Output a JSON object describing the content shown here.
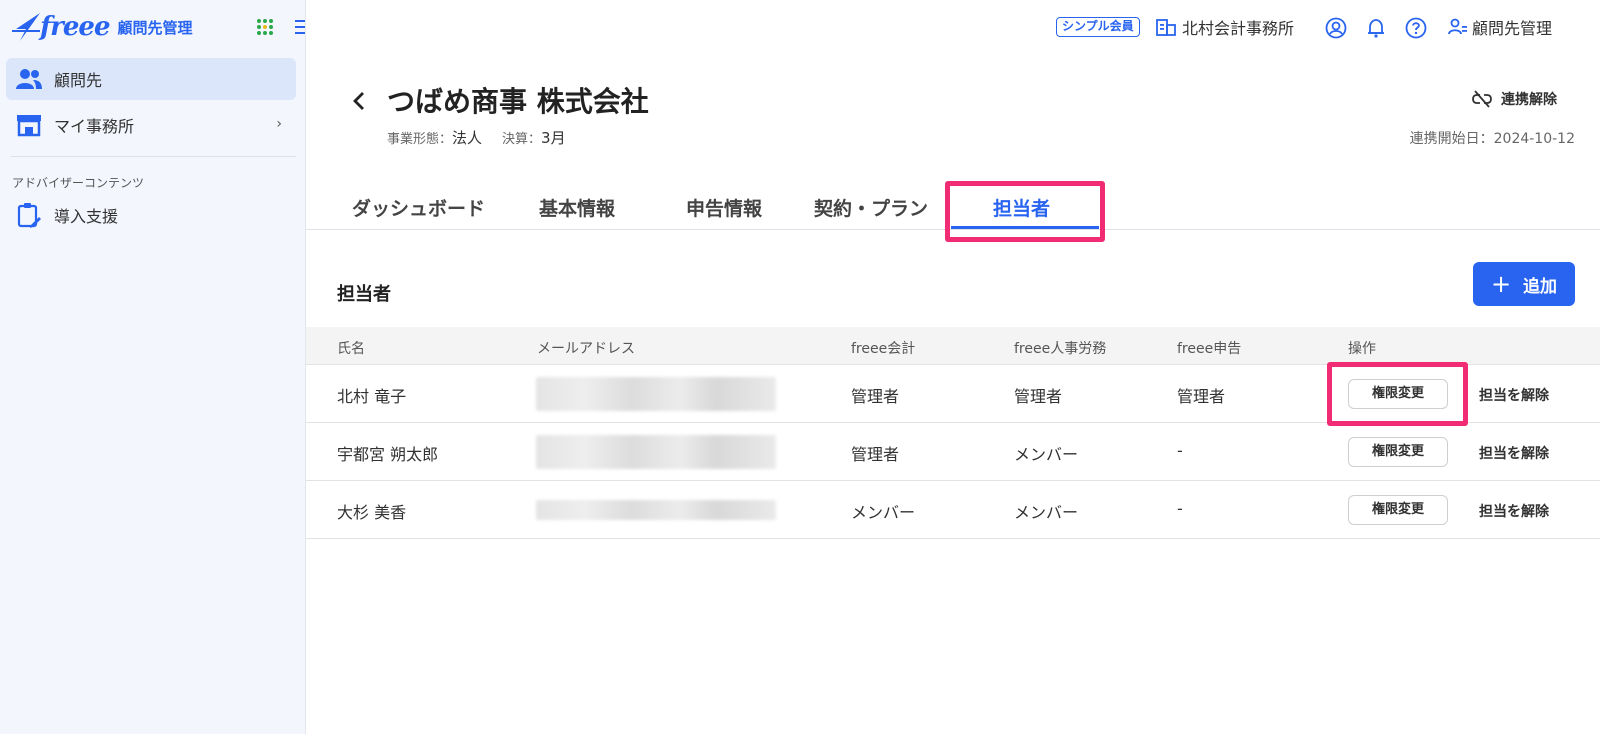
{
  "brand": {
    "logo_text": "freee",
    "app_name": "顧問先管理",
    "accent": "#2864f0",
    "highlight": "#f22c74"
  },
  "sidebar": {
    "items": [
      {
        "label": "顧問先",
        "icon": "people-icon",
        "active": true
      },
      {
        "label": "マイ事務所",
        "icon": "office-icon",
        "active": false,
        "chevron": "›"
      }
    ],
    "section_title": "アドバイザーコンテンツ",
    "section_items": [
      {
        "label": "導入支援",
        "icon": "clipboard-edit-icon"
      }
    ]
  },
  "header": {
    "plan_badge": "シンプル会員",
    "office_name": "北村会計事務所",
    "icons": [
      "account-icon",
      "bell-icon",
      "help-icon"
    ],
    "role_label": "顧問先管理"
  },
  "client": {
    "name": "つばめ商事 株式会社",
    "biz_type_label": "事業形態：",
    "biz_type": "法人",
    "fiscal_label": "決算：",
    "fiscal": "3月",
    "unlink_label": "連携解除",
    "linked_date": "連携開始日：2024-10-12"
  },
  "tabs": [
    {
      "label": "ダッシュボード",
      "active": false
    },
    {
      "label": "基本情報",
      "active": false
    },
    {
      "label": "申告情報",
      "active": false
    },
    {
      "label": "契約・プラン",
      "active": false
    },
    {
      "label": "担当者",
      "active": true
    }
  ],
  "section": {
    "title": "担当者",
    "add_label": "追加"
  },
  "table": {
    "columns": [
      "氏名",
      "メールアドレス",
      "freee会計",
      "freee人事労務",
      "freee申告",
      "操作"
    ],
    "rows": [
      {
        "name": "北村 竜子",
        "accounting": "管理者",
        "hr": "管理者",
        "tax": "管理者",
        "perm_btn": "権限変更",
        "remove": "担当を解除"
      },
      {
        "name": "宇都宮 朔太郎",
        "accounting": "管理者",
        "hr": "メンバー",
        "tax": "-",
        "perm_btn": "権限変更",
        "remove": "担当を解除"
      },
      {
        "name": "大杉 美香",
        "accounting": "メンバー",
        "hr": "メンバー",
        "tax": "-",
        "perm_btn": "権限変更",
        "remove": "担当を解除"
      }
    ]
  }
}
